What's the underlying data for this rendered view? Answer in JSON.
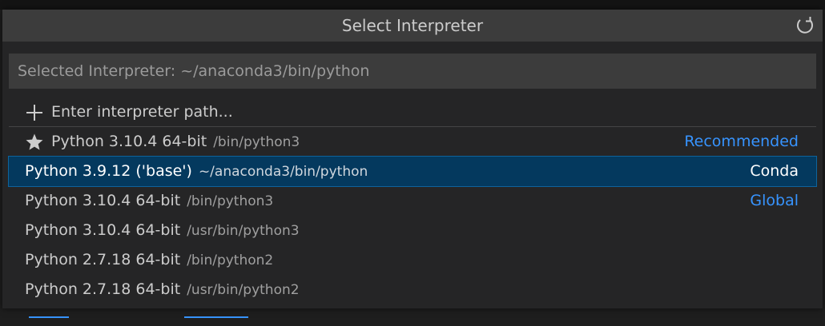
{
  "palette": {
    "title": "Select Interpreter",
    "refresh_icon": "refresh-icon",
    "input": {
      "placeholder": "Selected Interpreter: ~/anaconda3/bin/python",
      "value": ""
    },
    "enter_path": {
      "icon": "plus-icon",
      "label": "Enter interpreter path..."
    },
    "items": [
      {
        "icon": "star-icon",
        "label": "Python 3.10.4 64-bit",
        "path": "/bin/python3",
        "tag": "Recommended",
        "tag_style": "link"
      },
      {
        "label": "Python 3.9.12 ('base')",
        "path": "~/anaconda3/bin/python",
        "tag": "Conda",
        "tag_style": "plain",
        "selected": true
      },
      {
        "label": "Python 3.10.4 64-bit",
        "path": "/bin/python3",
        "tag": "Global",
        "tag_style": "link"
      },
      {
        "label": "Python 3.10.4 64-bit",
        "path": "/usr/bin/python3",
        "tag": ""
      },
      {
        "label": "Python 2.7.18 64-bit",
        "path": "/bin/python2",
        "tag": ""
      },
      {
        "label": "Python 2.7.18 64-bit",
        "path": "/usr/bin/python2",
        "tag": ""
      }
    ]
  },
  "colors": {
    "accent_link": "#3794ff",
    "selection_bg": "#04395e",
    "title_bar": "#3c3c3c",
    "list_bg": "#252526"
  }
}
